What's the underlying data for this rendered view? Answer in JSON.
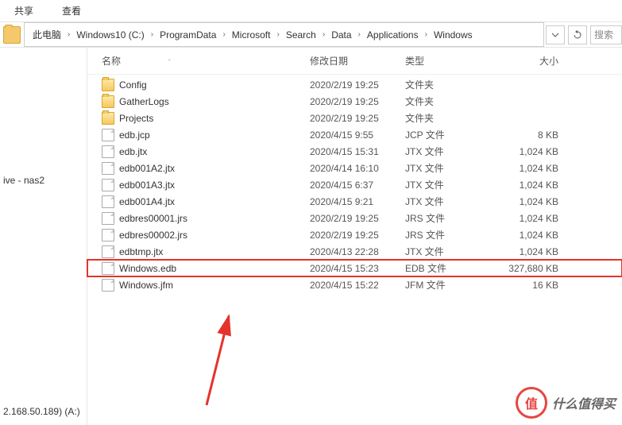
{
  "toolbar": {
    "share": "共享",
    "view": "查看"
  },
  "breadcrumbs": [
    "此电脑",
    "Windows10 (C:)",
    "ProgramData",
    "Microsoft",
    "Search",
    "Data",
    "Applications",
    "Windows"
  ],
  "search": {
    "placeholder": "搜索"
  },
  "sidebar": {
    "drive_label": "ive - nas2",
    "footer": "2.168.50.189) (A:)"
  },
  "columns": {
    "name": "名称",
    "date": "修改日期",
    "type": "类型",
    "size": "大小"
  },
  "files": [
    {
      "icon": "folder",
      "name": "Config",
      "date": "2020/2/19 19:25",
      "type": "文件夹",
      "size": ""
    },
    {
      "icon": "folder",
      "name": "GatherLogs",
      "date": "2020/2/19 19:25",
      "type": "文件夹",
      "size": ""
    },
    {
      "icon": "folder",
      "name": "Projects",
      "date": "2020/2/19 19:25",
      "type": "文件夹",
      "size": ""
    },
    {
      "icon": "file",
      "name": "edb.jcp",
      "date": "2020/4/15 9:55",
      "type": "JCP 文件",
      "size": "8 KB"
    },
    {
      "icon": "file",
      "name": "edb.jtx",
      "date": "2020/4/15 15:31",
      "type": "JTX 文件",
      "size": "1,024 KB"
    },
    {
      "icon": "file",
      "name": "edb001A2.jtx",
      "date": "2020/4/14 16:10",
      "type": "JTX 文件",
      "size": "1,024 KB"
    },
    {
      "icon": "file",
      "name": "edb001A3.jtx",
      "date": "2020/4/15 6:37",
      "type": "JTX 文件",
      "size": "1,024 KB"
    },
    {
      "icon": "file",
      "name": "edb001A4.jtx",
      "date": "2020/4/15 9:21",
      "type": "JTX 文件",
      "size": "1,024 KB"
    },
    {
      "icon": "file",
      "name": "edbres00001.jrs",
      "date": "2020/2/19 19:25",
      "type": "JRS 文件",
      "size": "1,024 KB"
    },
    {
      "icon": "file",
      "name": "edbres00002.jrs",
      "date": "2020/2/19 19:25",
      "type": "JRS 文件",
      "size": "1,024 KB"
    },
    {
      "icon": "file",
      "name": "edbtmp.jtx",
      "date": "2020/4/13 22:28",
      "type": "JTX 文件",
      "size": "1,024 KB"
    },
    {
      "icon": "file",
      "name": "Windows.edb",
      "date": "2020/4/15 15:23",
      "type": "EDB 文件",
      "size": "327,680 KB",
      "highlight": true
    },
    {
      "icon": "file",
      "name": "Windows.jfm",
      "date": "2020/4/15 15:22",
      "type": "JFM 文件",
      "size": "16 KB"
    }
  ],
  "watermark": {
    "text": "什么值得买",
    "badge": "值"
  }
}
